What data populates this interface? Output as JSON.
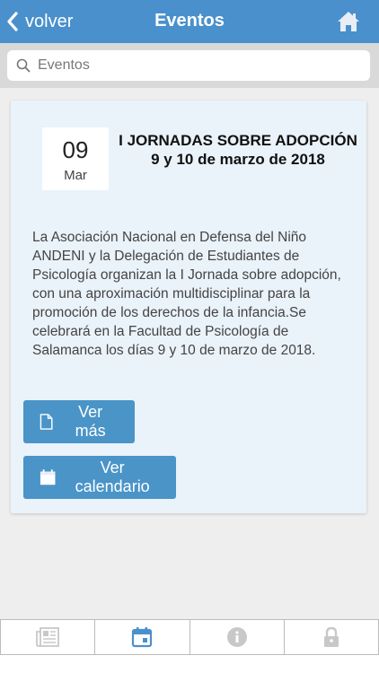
{
  "header": {
    "back_label": "volver",
    "title": "Eventos",
    "color": "#4a90cc"
  },
  "search": {
    "placeholder": "Eventos",
    "value": ""
  },
  "event": {
    "day": "09",
    "month": "Mar",
    "title": "I JORNADAS SOBRE ADOPCIÓN 9 y 10 de marzo de 2018",
    "description": "La Asociación Nacional en Defensa del Niño ANDENI y la Delegación de Estudiantes de Psicología organizan la I Jornada sobre adopción, con una aproximación multidisciplinar para la promoción de los derechos de la infancia.Se celebrará en la Facultad de Psicología de Salamanca los días 9 y 10 de marzo de 2018.",
    "more_label": "Ver más",
    "calendar_label": "Ver calendario"
  },
  "tabs": [
    {
      "icon": "newspaper-icon",
      "active": false
    },
    {
      "icon": "calendar-icon",
      "active": true
    },
    {
      "icon": "info-icon",
      "active": false
    },
    {
      "icon": "lock-icon",
      "active": false
    }
  ],
  "colors": {
    "accent": "#4a94c8",
    "tab_active": "#4a90cc",
    "tab_inactive": "#c8c8c8"
  }
}
